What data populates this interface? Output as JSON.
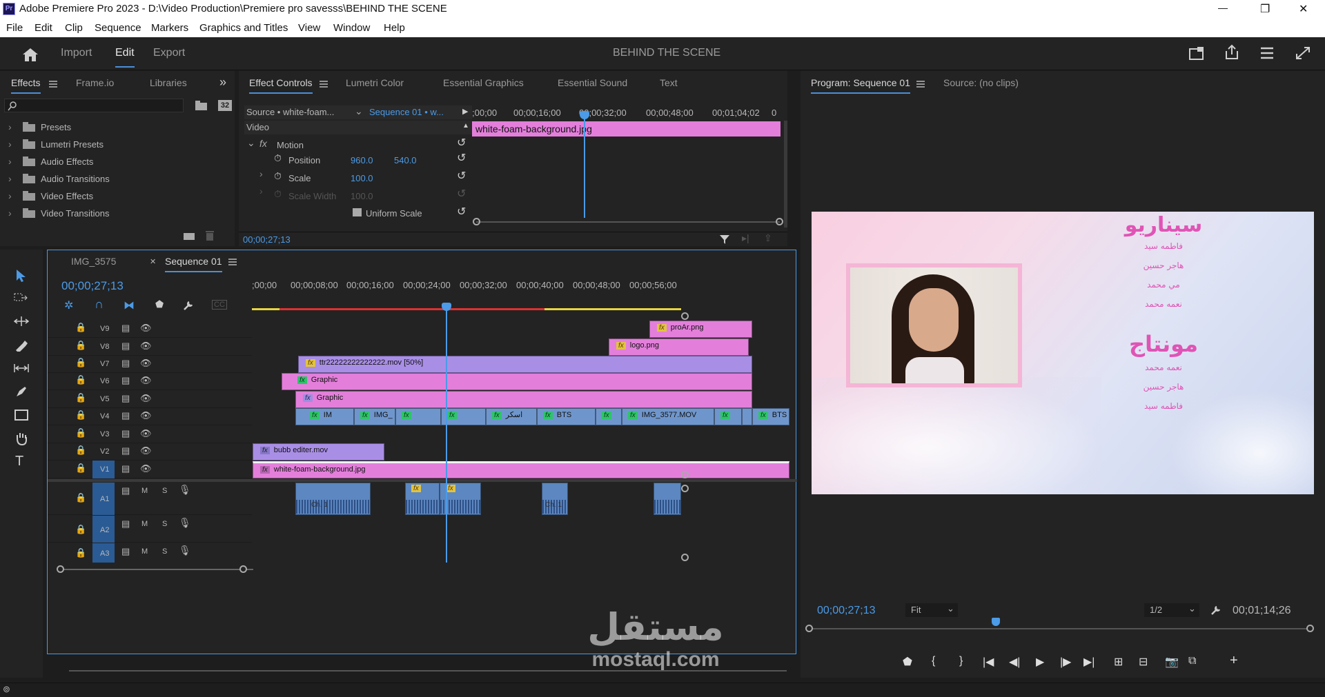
{
  "window": {
    "title": "Adobe Premiere Pro 2023 - D:\\Video Production\\Premiere pro savesss\\BEHIND THE SCENE",
    "minimize": "—",
    "restore": "❐",
    "close": "✕"
  },
  "menu": [
    "File",
    "Edit",
    "Clip",
    "Sequence",
    "Markers",
    "Graphics and Titles",
    "View",
    "Window",
    "Help"
  ],
  "workspace": {
    "tabs": [
      "Import",
      "Edit",
      "Export"
    ],
    "active": "Edit",
    "project_title": "BEHIND THE SCENE"
  },
  "effects_panel": {
    "tabs": [
      "Effects",
      "Frame.io",
      "Libraries"
    ],
    "folders": [
      "Presets",
      "Lumetri Presets",
      "Audio Effects",
      "Audio Transitions",
      "Video Effects",
      "Video Transitions"
    ],
    "bin_badge": "32"
  },
  "effect_controls": {
    "tabs": [
      "Effect Controls",
      "Lumetri Color",
      "Essential Graphics",
      "Essential Sound",
      "Text"
    ],
    "source_label": "Source • white-foam...",
    "sequence_label": "Sequence 01 • w...",
    "timecodes": [
      ";00;00",
      "00;00;16;00",
      "00;00;32;00",
      "00;00;48;00",
      "00;01;04;02",
      "0"
    ],
    "video_label": "Video",
    "fx_label": "fx",
    "motion_label": "Motion",
    "position_label": "Position",
    "position_x": "960.0",
    "position_y": "540.0",
    "scale_label": "Scale",
    "scale_value": "100.0",
    "scale_width_label": "Scale Width",
    "scale_width_value": "100.0",
    "uniform_scale_label": "Uniform Scale",
    "clip_name": "white-foam-background.jpg",
    "current_time": "00;00;27;13"
  },
  "program_monitor": {
    "tabs": [
      "Program: Sequence 01",
      "Source: (no clips)"
    ],
    "timecode": "00;00;27;13",
    "fit": "Fit",
    "resolution": "1/2",
    "duration": "00;01;14;26",
    "credits": {
      "heading1": "سيناريو",
      "names1": [
        "فاطمه سيد",
        "هاجر حسين",
        "مي محمد",
        "نعمه محمد"
      ],
      "heading2": "مونتاج",
      "names2": [
        "نعمه محمد",
        "هاجر حسين",
        "فاطمه سيد"
      ]
    }
  },
  "timeline": {
    "tabs": [
      "IMG_3575",
      "Sequence 01"
    ],
    "close": "✕",
    "timecode": "00;00;27;13",
    "ruler": [
      ";00;00",
      "00;00;08;00",
      "00;00;16;00",
      "00;00;24;00",
      "00;00;32;00",
      "00;00;40;00",
      "00;00;48;00",
      "00;00;56;00"
    ],
    "video_tracks": [
      "V9",
      "V8",
      "V7",
      "V6",
      "V5",
      "V4",
      "V3",
      "V2",
      "V1"
    ],
    "audio_tracks": [
      "A1",
      "A2",
      "A3"
    ],
    "audio_buttons": {
      "mute": "M",
      "solo": "S"
    },
    "clips": {
      "v9": "proAr.png",
      "v8": "logo.png",
      "v7": "ttr22222222222222.mov [50%]",
      "v6": "Graphic",
      "v5": "Graphic",
      "v4": [
        "IM",
        "IMG_",
        "اسكر",
        "BTS",
        "IMG_3577.MOV",
        "BTS"
      ],
      "v2": "bubb editer.mov",
      "v1": "white-foam-background.jpg",
      "a1_labels": [
        "Ch. 1",
        "Ch. 1"
      ]
    }
  },
  "watermark": {
    "arabic": "مستقل",
    "latin": "mostaql.com"
  },
  "colors": {
    "accent": "#4b9be8",
    "pink_clip": "#e37fdb",
    "purple_clip": "#a98ee6",
    "blue_clip": "#6f96cc",
    "fx_badge": "#e2c341"
  }
}
